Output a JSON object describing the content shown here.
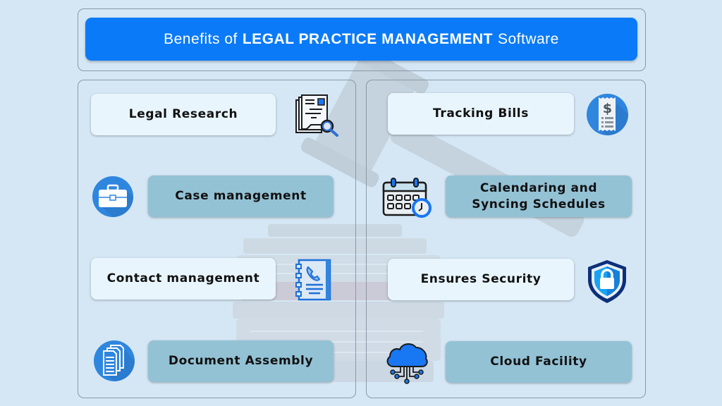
{
  "title": {
    "prefix": "Benefits of",
    "emphasis": "LEGAL PRACTICE MANAGEMENT",
    "suffix": "Software"
  },
  "colors": {
    "background": "#d5e7f5",
    "title_bar": "#0a7af8",
    "card_light": "#e8f5fd",
    "card_dark": "#93c2d5",
    "icon_blue": "#2f86de",
    "icon_accent": "#1877f2"
  },
  "left_column": [
    {
      "label": "Legal Research",
      "icon": "document-search-icon",
      "style": "light"
    },
    {
      "label": "Case management",
      "icon": "briefcase-icon",
      "style": "dark"
    },
    {
      "label": "Contact management",
      "icon": "contact-book-icon",
      "style": "light"
    },
    {
      "label": "Document Assembly",
      "icon": "documents-icon",
      "style": "dark"
    }
  ],
  "right_column": [
    {
      "label": "Tracking Bills",
      "icon": "bill-receipt-icon",
      "style": "light"
    },
    {
      "label": "Calendaring and Syncing Schedules",
      "label_line1": "Calendaring and",
      "label_line2": "Syncing Schedules",
      "icon": "calendar-clock-icon",
      "style": "dark"
    },
    {
      "label": "Ensures Security",
      "icon": "security-shield-icon",
      "style": "light"
    },
    {
      "label": "Cloud Facility",
      "icon": "cloud-network-icon",
      "style": "dark"
    }
  ]
}
